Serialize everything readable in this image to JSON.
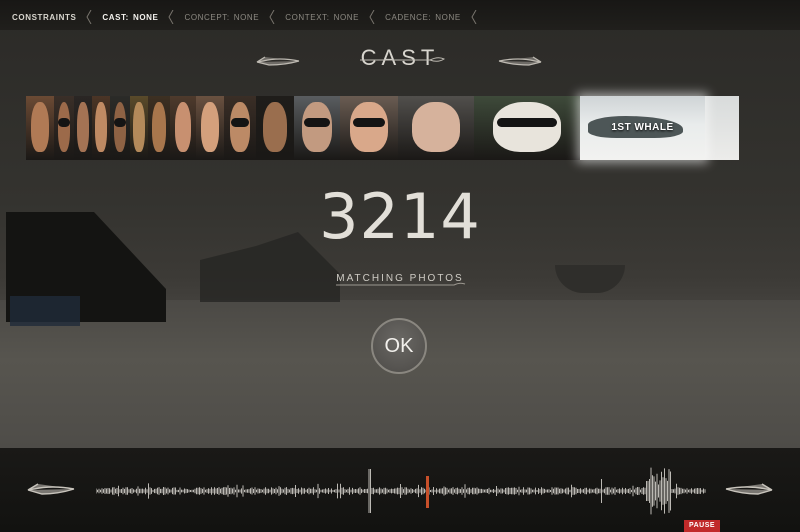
{
  "breadcrumb": [
    {
      "key": "CONSTRAINTS",
      "value": "",
      "active": false
    },
    {
      "key": "CAST:",
      "value": "NONE",
      "active": true
    },
    {
      "key": "CONCEPT:",
      "value": "NONE",
      "active": false
    },
    {
      "key": "CONTEXT:",
      "value": "NONE",
      "active": false
    },
    {
      "key": "CADENCE:",
      "value": "NONE",
      "active": false
    }
  ],
  "header": {
    "title": "CAST"
  },
  "filmstrip": {
    "thumbs": [
      {
        "icon": "face-thumb",
        "bg": "#6b4a34",
        "skin": "#b07a55"
      },
      {
        "icon": "face-thumb",
        "bg": "#3a2f28",
        "skin": "#9c6a4a"
      },
      {
        "icon": "face-thumb",
        "bg": "#2a2624",
        "skin": "#a47354"
      },
      {
        "icon": "face-thumb",
        "bg": "#4b3526",
        "skin": "#c08a63"
      },
      {
        "icon": "face-thumb",
        "bg": "#2b2b28",
        "skin": "#8e6244"
      },
      {
        "icon": "face-thumb",
        "bg": "#5a4a2a",
        "skin": "#b48a5a"
      },
      {
        "icon": "face-thumb",
        "bg": "#3d3022",
        "skin": "#a8764c"
      },
      {
        "icon": "face-thumb",
        "bg": "#4e3a2c",
        "skin": "#c89070"
      },
      {
        "icon": "face-thumb",
        "bg": "#6a5140",
        "skin": "#d4a07c"
      },
      {
        "icon": "face-thumb",
        "bg": "#3a2e26",
        "skin": "#bc8a66"
      },
      {
        "icon": "face-thumb",
        "bg": "#1f1d1a",
        "skin": "#9a6e4e"
      },
      {
        "icon": "face-thumb",
        "bg": "#5a5d60",
        "skin": "#c29a80"
      },
      {
        "icon": "face-thumb",
        "bg": "#6a5c52",
        "skin": "#d9a88a"
      },
      {
        "icon": "face-thumb",
        "bg": "#514f4c",
        "skin": "#d6b29c"
      },
      {
        "icon": "face-thumb",
        "bg": "#3e4a3a",
        "skin": "#e8e4dc"
      }
    ],
    "highlight": {
      "label": "1ST WHALE"
    }
  },
  "result": {
    "count": "3214",
    "label": "MATCHING PHOTOS"
  },
  "ok_button": {
    "label": "OK"
  },
  "player": {
    "pause_label": "PAUSE"
  },
  "colors": {
    "accent": "#c8502a",
    "pause": "#c12a2a"
  }
}
